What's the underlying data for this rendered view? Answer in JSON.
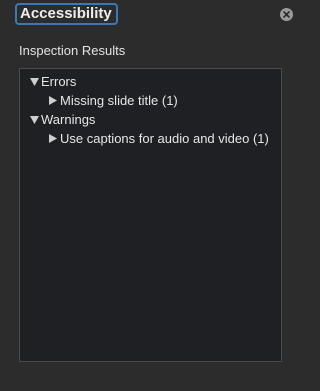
{
  "header": {
    "title": "Accessibility",
    "close_icon": "close-icon"
  },
  "results": {
    "label": "Inspection Results",
    "groups": [
      {
        "label": "Errors",
        "expanded": true,
        "items": [
          {
            "label": "Missing slide title (1)",
            "expanded": false
          }
        ]
      },
      {
        "label": "Warnings",
        "expanded": true,
        "items": [
          {
            "label": "Use captions for audio and video (1)",
            "expanded": false
          }
        ]
      }
    ]
  },
  "colors": {
    "background": "#2c2c2d",
    "tree_background": "#1f2023",
    "focus_ring": "#3b78b5",
    "text": "#e6e6e6"
  }
}
